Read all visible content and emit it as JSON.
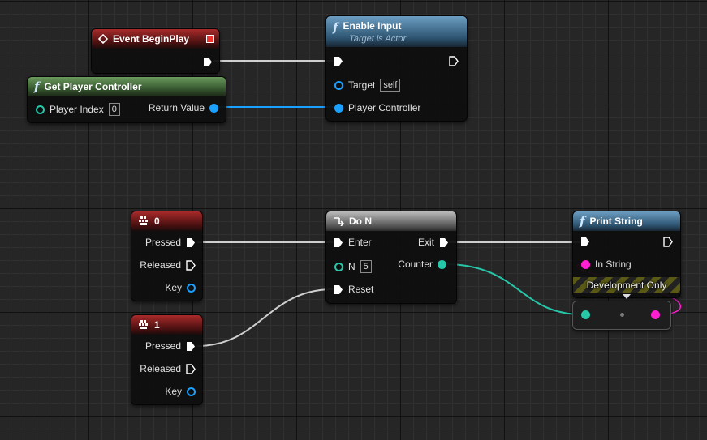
{
  "nodes": {
    "begin_play": {
      "title": "Event BeginPlay"
    },
    "get_player_controller": {
      "title": "Get Player Controller",
      "player_index_label": "Player Index",
      "player_index_value": "0",
      "return_value_label": "Return Value"
    },
    "enable_input": {
      "title": "Enable Input",
      "subtitle": "Target is Actor",
      "target_label": "Target",
      "target_value": "self",
      "player_controller_label": "Player Controller"
    },
    "key0": {
      "title": "0",
      "pressed": "Pressed",
      "released": "Released",
      "key": "Key"
    },
    "key1": {
      "title": "1",
      "pressed": "Pressed",
      "released": "Released",
      "key": "Key"
    },
    "do_n": {
      "title": "Do N",
      "enter": "Enter",
      "n_label": "N",
      "n_value": "5",
      "reset": "Reset",
      "exit": "Exit",
      "counter": "Counter"
    },
    "print_string": {
      "title": "Print String",
      "in_string": "In String",
      "dev_only": "Development Only"
    }
  },
  "colors": {
    "event_header": "#a82a2a",
    "pure_header": "#6a9a5c",
    "function_header": "#6c9ec2",
    "macro_header": "#bcbcbc",
    "integer_pin": "#26c6a8",
    "object_pin": "#1aa0ff",
    "string_pin": "#ff1ed0",
    "exec_wire": "#d8d8d8"
  }
}
